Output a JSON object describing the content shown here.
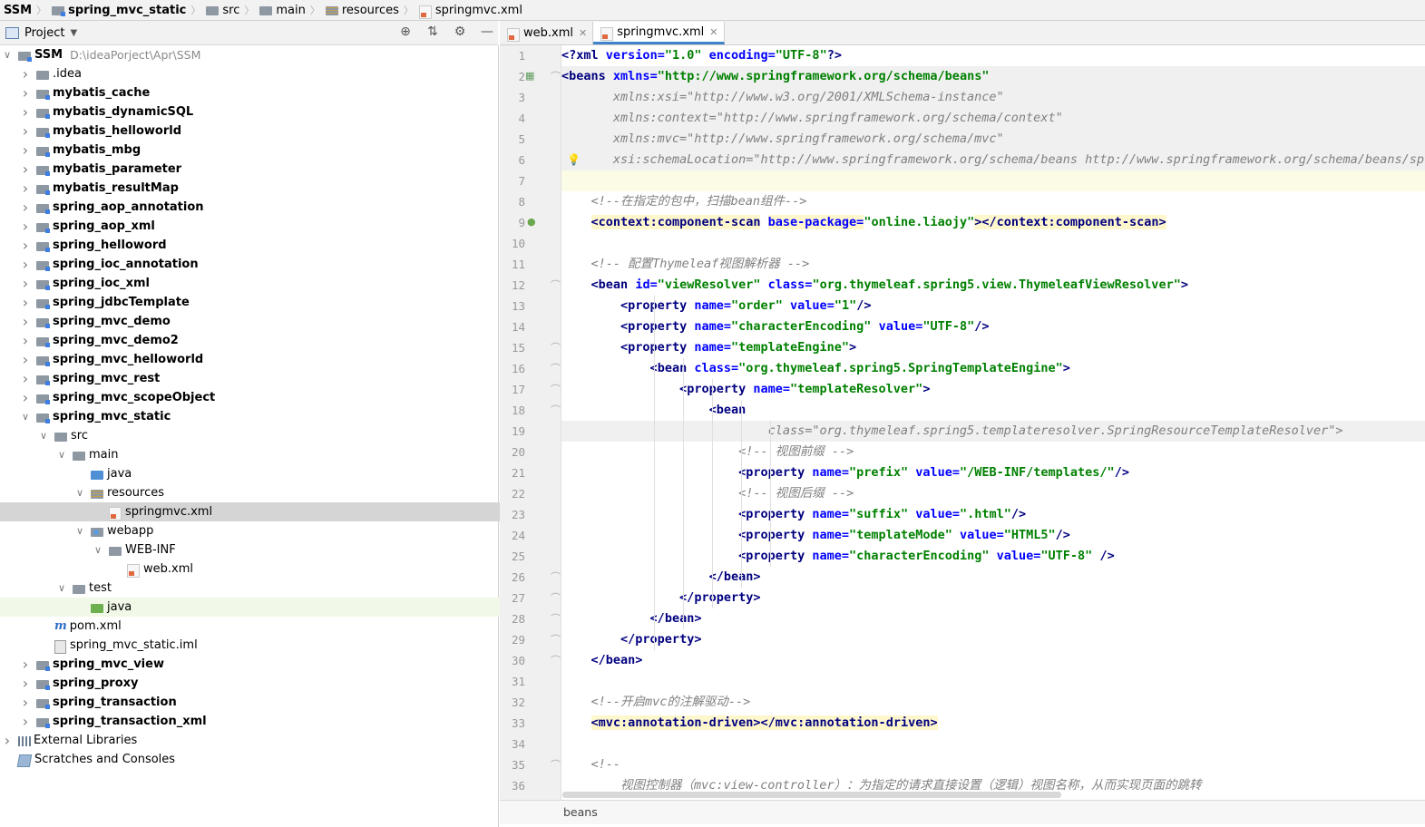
{
  "breadcrumbs": [
    "SSM",
    "spring_mvc_static",
    "src",
    "main",
    "resources",
    "springmvc.xml"
  ],
  "project_panel": {
    "title": "Project"
  },
  "tree": [
    {
      "label": "SSM",
      "path": "D:\\ideaPorject\\Apr\\SSM",
      "bold": true,
      "depth": 0,
      "arrow": "down",
      "icon": "module-folder"
    },
    {
      "label": ".idea",
      "depth": 1,
      "arrow": "right",
      "icon": "folder"
    },
    {
      "label": "mybatis_cache",
      "depth": 1,
      "arrow": "right",
      "bold": true,
      "icon": "module-folder"
    },
    {
      "label": "mybatis_dynamicSQL",
      "depth": 1,
      "arrow": "right",
      "bold": true,
      "icon": "module-folder"
    },
    {
      "label": "mybatis_helloworld",
      "depth": 1,
      "arrow": "right",
      "bold": true,
      "icon": "module-folder"
    },
    {
      "label": "mybatis_mbg",
      "depth": 1,
      "arrow": "right",
      "bold": true,
      "icon": "module-folder"
    },
    {
      "label": "mybatis_parameter",
      "depth": 1,
      "arrow": "right",
      "bold": true,
      "icon": "module-folder"
    },
    {
      "label": "mybatis_resultMap",
      "depth": 1,
      "arrow": "right",
      "bold": true,
      "icon": "module-folder"
    },
    {
      "label": "spring_aop_annotation",
      "depth": 1,
      "arrow": "right",
      "bold": true,
      "icon": "module-folder"
    },
    {
      "label": "spring_aop_xml",
      "depth": 1,
      "arrow": "right",
      "bold": true,
      "icon": "module-folder"
    },
    {
      "label": "spring_helloword",
      "depth": 1,
      "arrow": "right",
      "bold": true,
      "icon": "module-folder"
    },
    {
      "label": "spring_ioc_annotation",
      "depth": 1,
      "arrow": "right",
      "bold": true,
      "icon": "module-folder"
    },
    {
      "label": "spring_ioc_xml",
      "depth": 1,
      "arrow": "right",
      "bold": true,
      "icon": "module-folder"
    },
    {
      "label": "spring_jdbcTemplate",
      "depth": 1,
      "arrow": "right",
      "bold": true,
      "icon": "module-folder"
    },
    {
      "label": "spring_mvc_demo",
      "depth": 1,
      "arrow": "right",
      "bold": true,
      "icon": "module-folder"
    },
    {
      "label": "spring_mvc_demo2",
      "depth": 1,
      "arrow": "right",
      "bold": true,
      "icon": "module-folder"
    },
    {
      "label": "spring_mvc_helloworld",
      "depth": 1,
      "arrow": "right",
      "bold": true,
      "icon": "module-folder"
    },
    {
      "label": "spring_mvc_rest",
      "depth": 1,
      "arrow": "right",
      "bold": true,
      "icon": "module-folder"
    },
    {
      "label": "spring_mvc_scopeObject",
      "depth": 1,
      "arrow": "right",
      "bold": true,
      "icon": "module-folder"
    },
    {
      "label": "spring_mvc_static",
      "depth": 1,
      "arrow": "down",
      "bold": true,
      "icon": "module-folder"
    },
    {
      "label": "src",
      "depth": 2,
      "arrow": "down",
      "icon": "folder"
    },
    {
      "label": "main",
      "depth": 3,
      "arrow": "down",
      "icon": "folder"
    },
    {
      "label": "java",
      "depth": 4,
      "arrow": "",
      "icon": "source-folder"
    },
    {
      "label": "resources",
      "depth": 4,
      "arrow": "down",
      "icon": "resources-folder"
    },
    {
      "label": "springmvc.xml",
      "depth": 5,
      "arrow": "",
      "icon": "xml-file",
      "selected": true
    },
    {
      "label": "webapp",
      "depth": 4,
      "arrow": "down",
      "icon": "web-folder"
    },
    {
      "label": "WEB-INF",
      "depth": 5,
      "arrow": "down",
      "icon": "folder"
    },
    {
      "label": "web.xml",
      "depth": 6,
      "arrow": "",
      "icon": "xml-file"
    },
    {
      "label": "test",
      "depth": 3,
      "arrow": "down",
      "icon": "folder"
    },
    {
      "label": "java",
      "depth": 4,
      "arrow": "",
      "icon": "test-folder",
      "highlight": true
    },
    {
      "label": "pom.xml",
      "depth": 2,
      "arrow": "",
      "icon": "maven-file"
    },
    {
      "label": "spring_mvc_static.iml",
      "depth": 2,
      "arrow": "",
      "icon": "iml-file"
    },
    {
      "label": "spring_mvc_view",
      "depth": 1,
      "arrow": "right",
      "bold": true,
      "icon": "module-folder"
    },
    {
      "label": "spring_proxy",
      "depth": 1,
      "arrow": "right",
      "bold": true,
      "icon": "module-folder"
    },
    {
      "label": "spring_transaction",
      "depth": 1,
      "arrow": "right",
      "bold": true,
      "icon": "module-folder"
    },
    {
      "label": "spring_transaction_xml",
      "depth": 1,
      "arrow": "right",
      "bold": true,
      "icon": "module-folder"
    },
    {
      "label": "External Libraries",
      "depth": 0,
      "arrow": "right",
      "icon": "library"
    },
    {
      "label": "Scratches and Consoles",
      "depth": 0,
      "arrow": "",
      "icon": "scratch"
    }
  ],
  "tabs": [
    {
      "label": "web.xml",
      "active": false
    },
    {
      "label": "springmvc.xml",
      "active": true
    }
  ],
  "code_lines": [
    "<?xml version=\"1.0\" encoding=\"UTF-8\"?>",
    "<beans xmlns=\"http://www.springframework.org/schema/beans\"",
    "       xmlns:xsi=\"http://www.w3.org/2001/XMLSchema-instance\"",
    "       xmlns:context=\"http://www.springframework.org/schema/context\"",
    "       xmlns:mvc=\"http://www.springframework.org/schema/mvc\"",
    "       xsi:schemaLocation=\"http://www.springframework.org/schema/beans http://www.springframework.org/schema/beans/spri",
    "",
    "    <!--在指定的包中，扫描bean组件-->",
    "    <context:component-scan base-package=\"online.liaojy\"></context:component-scan>",
    "",
    "    <!-- 配置Thymeleaf视图解析器 -->",
    "    <bean id=\"viewResolver\" class=\"org.thymeleaf.spring5.view.ThymeleafViewResolver\">",
    "        <property name=\"order\" value=\"1\"/>",
    "        <property name=\"characterEncoding\" value=\"UTF-8\"/>",
    "        <property name=\"templateEngine\">",
    "            <bean class=\"org.thymeleaf.spring5.SpringTemplateEngine\">",
    "                <property name=\"templateResolver\">",
    "                    <bean",
    "                            class=\"org.thymeleaf.spring5.templateresolver.SpringResourceTemplateResolver\">",
    "                        <!-- 视图前缀 -->",
    "                        <property name=\"prefix\" value=\"/WEB-INF/templates/\"/>",
    "                        <!-- 视图后缀 -->",
    "                        <property name=\"suffix\" value=\".html\"/>",
    "                        <property name=\"templateMode\" value=\"HTML5\"/>",
    "                        <property name=\"characterEncoding\" value=\"UTF-8\" />",
    "                    </bean>",
    "                </property>",
    "            </bean>",
    "        </property>",
    "    </bean>",
    "",
    "    <!--开启mvc的注解驱动-->",
    "    <mvc:annotation-driven></mvc:annotation-driven>",
    "",
    "    <!--",
    "        视图控制器（mvc:view-controller）：为指定的请求直接设置（逻辑）视图名称，从而实现页面的跳转"
  ],
  "status": {
    "breadcrumb": "beans"
  }
}
